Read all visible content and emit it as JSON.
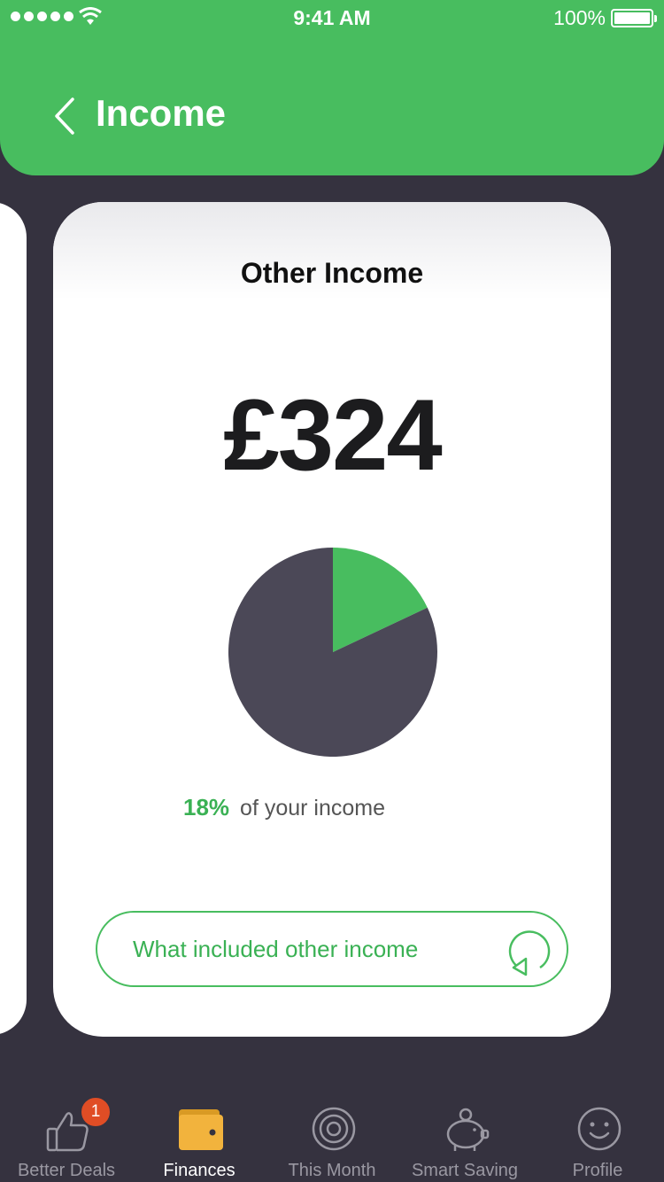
{
  "status_bar": {
    "time": "9:41 AM",
    "battery": "100%"
  },
  "header": {
    "title": "Income"
  },
  "card": {
    "title": "Other Income",
    "amount": "£324",
    "share_percent": "18%",
    "share_text": "of your income",
    "button_label": "What included other income"
  },
  "chart_data": {
    "type": "pie",
    "slices": [
      {
        "value": 18,
        "color": "#48bd5f"
      },
      {
        "value": 82,
        "color": "#4b4857"
      }
    ]
  },
  "tabbar": {
    "tabs": [
      {
        "label": "Better Deals",
        "icon": "thumbs-up-icon",
        "badge": "1"
      },
      {
        "label": "Finances",
        "icon": "wallet-icon",
        "active": true
      },
      {
        "label": "This Month",
        "icon": "target-icon"
      },
      {
        "label": "Smart Saving",
        "icon": "piggy-bank-icon"
      },
      {
        "label": "Profile",
        "icon": "smiley-icon"
      }
    ]
  },
  "colors": {
    "accent": "#48bd5f",
    "background": "#35323f",
    "badge": "#e04d25",
    "wallet": "#f2b33d"
  }
}
